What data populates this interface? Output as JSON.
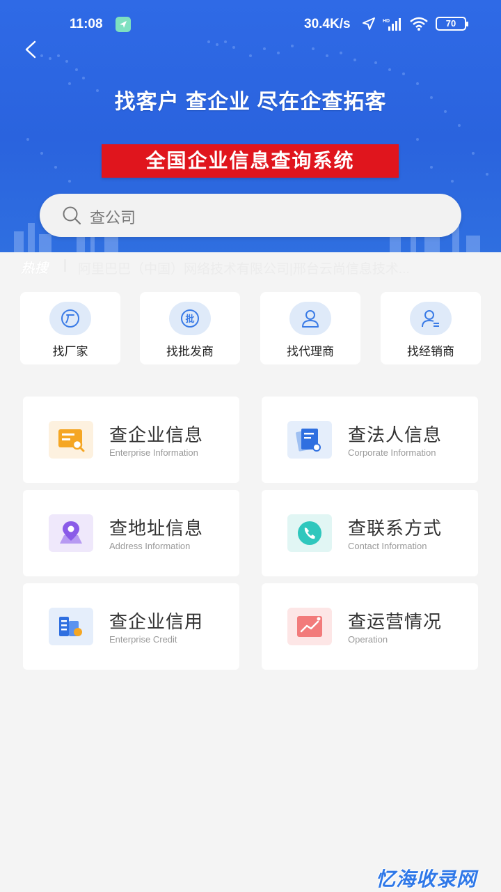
{
  "status": {
    "time": "11:08",
    "speed": "30.4K/s",
    "battery": "70"
  },
  "banner": {
    "title": "找客户 查企业 尽在企查拓客",
    "subtitle": "全国企业信息查询系统"
  },
  "search": {
    "placeholder": "查公司"
  },
  "hot": {
    "label": "热搜",
    "text": "阿里巴巴（中国）网络技术有限公司|邢台云尚信息技术..."
  },
  "quick": [
    {
      "label": "找厂家",
      "icon": "factory-icon"
    },
    {
      "label": "找批发商",
      "icon": "wholesale-icon"
    },
    {
      "label": "找代理商",
      "icon": "agent-icon"
    },
    {
      "label": "找经销商",
      "icon": "dealer-icon"
    }
  ],
  "cards": [
    {
      "title": "查企业信息",
      "sub": "Enterprise Information",
      "icon": "enterprise-info-icon",
      "color": "#fdf1df"
    },
    {
      "title": "查法人信息",
      "sub": "Corporate Information",
      "icon": "corporate-info-icon",
      "color": "#e5eefb"
    },
    {
      "title": "查地址信息",
      "sub": "Address Information",
      "icon": "address-icon",
      "color": "#efe8fb"
    },
    {
      "title": "查联系方式",
      "sub": "Contact Information",
      "icon": "phone-icon",
      "color": "#e1f6f4"
    },
    {
      "title": "查企业信用",
      "sub": "Enterprise Credit",
      "icon": "credit-icon",
      "color": "#e5eefb"
    },
    {
      "title": "查运营情况",
      "sub": "Operation",
      "icon": "operation-icon",
      "color": "#fde6e6"
    }
  ],
  "watermark": "忆海收录网"
}
